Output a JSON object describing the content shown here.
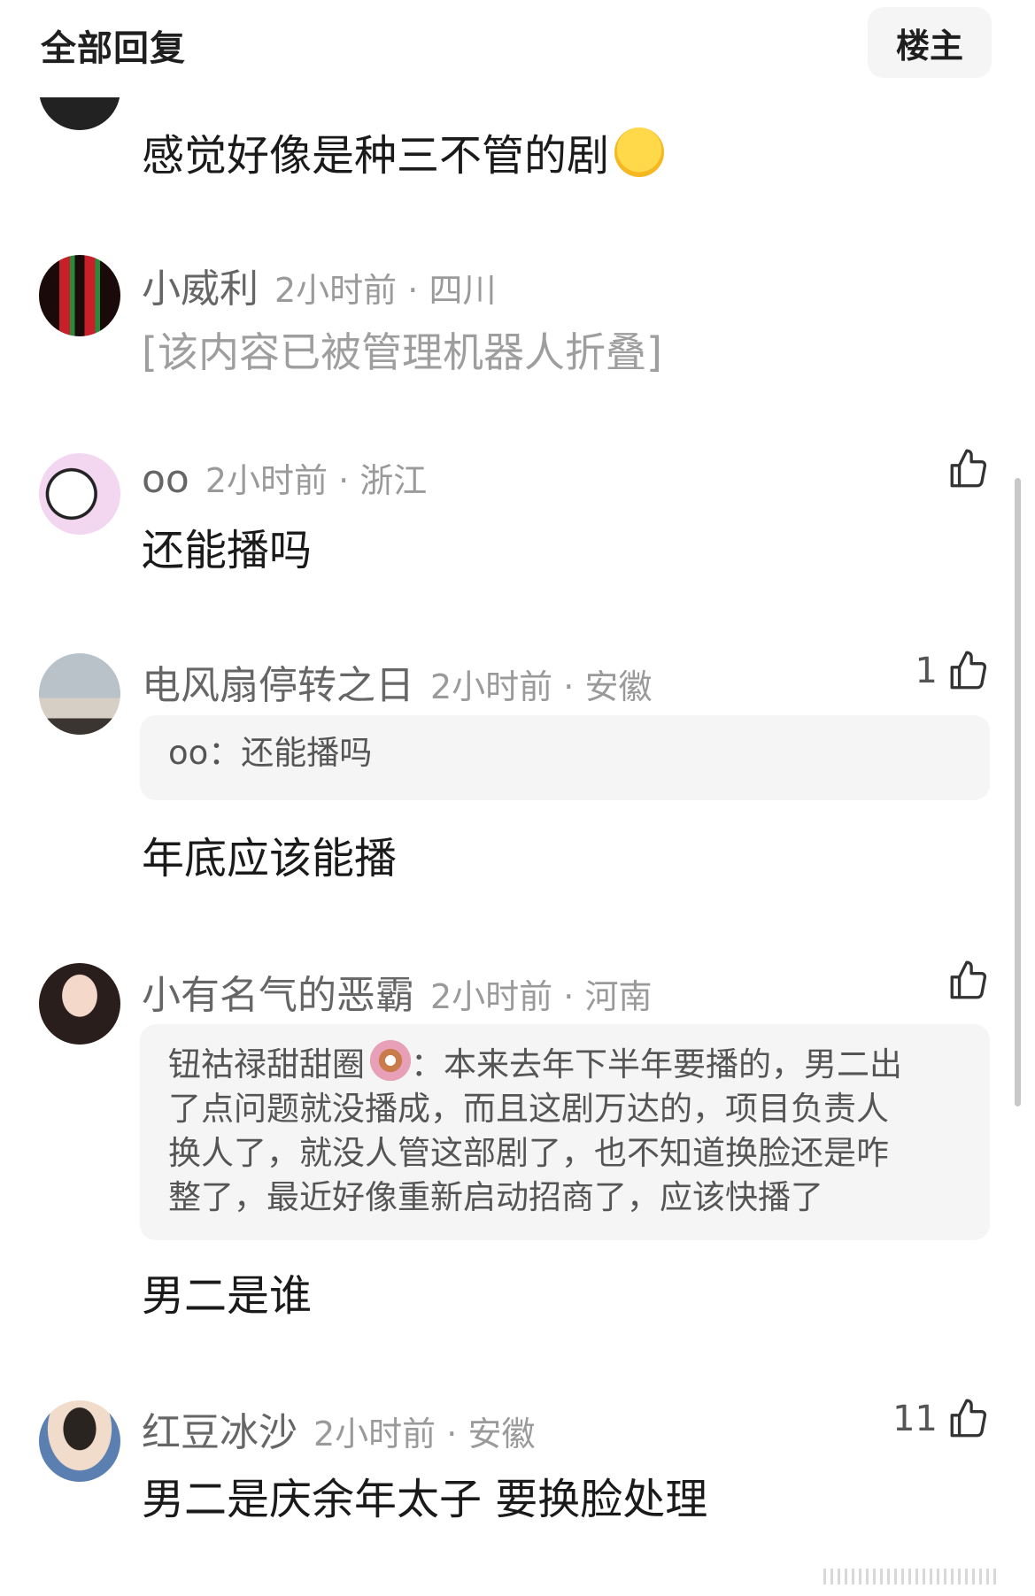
{
  "header": {
    "title": "全部回复",
    "filter_label": "楼主"
  },
  "comments": [
    {
      "username": "",
      "text": "感觉好像是种三不管的剧",
      "emoji": "relieved-face"
    },
    {
      "username": "小威利",
      "time": "2小时前",
      "dot": " · ",
      "location": "四川",
      "text": "[该内容已被管理机器人折叠]",
      "folded": true
    },
    {
      "username": "oo",
      "time": "2小时前",
      "dot": " · ",
      "location": "浙江",
      "text": "还能播吗",
      "likes": ""
    },
    {
      "username": "电风扇停转之日",
      "time": "2小时前",
      "dot": " · ",
      "location": "安徽",
      "likes": "1",
      "quote": {
        "author": "oo",
        "sep": "：",
        "text": "还能播吗"
      },
      "text": "年底应该能播"
    },
    {
      "username": "小有名气的恶霸",
      "time": "2小时前",
      "dot": " · ",
      "location": "河南",
      "likes": "",
      "quote": {
        "author": "钮祜禄甜甜圈",
        "emoji": "doughnut",
        "sep": "：",
        "text": "本来去年下半年要播的，男二出了点问题就没播成，而且这剧万达的，项目负责人换人了，就没人管这部剧了，也不知道换脸还是咋整了，最近好像重新启动招商了，应该快播了",
        "lines": [
          "本来去年下半年要播的，男二出",
          "了点问题就没播成，而且这剧万达的，项目负责人",
          "换人了，就没人管这部剧了，也不知道换脸还是咋",
          "整了，最近好像重新启动招商了，应该快播了"
        ]
      },
      "text": "男二是谁"
    },
    {
      "username": "红豆冰沙",
      "time": "2小时前",
      "dot": " · ",
      "location": "安徽",
      "likes": "11",
      "text": "男二是庆余年太子 要换脸处理"
    }
  ],
  "colors": {
    "text": "#1a1a1a",
    "meta": "#9a9a9a",
    "quote_bg": "#f5f5f5",
    "username": "#666666"
  }
}
